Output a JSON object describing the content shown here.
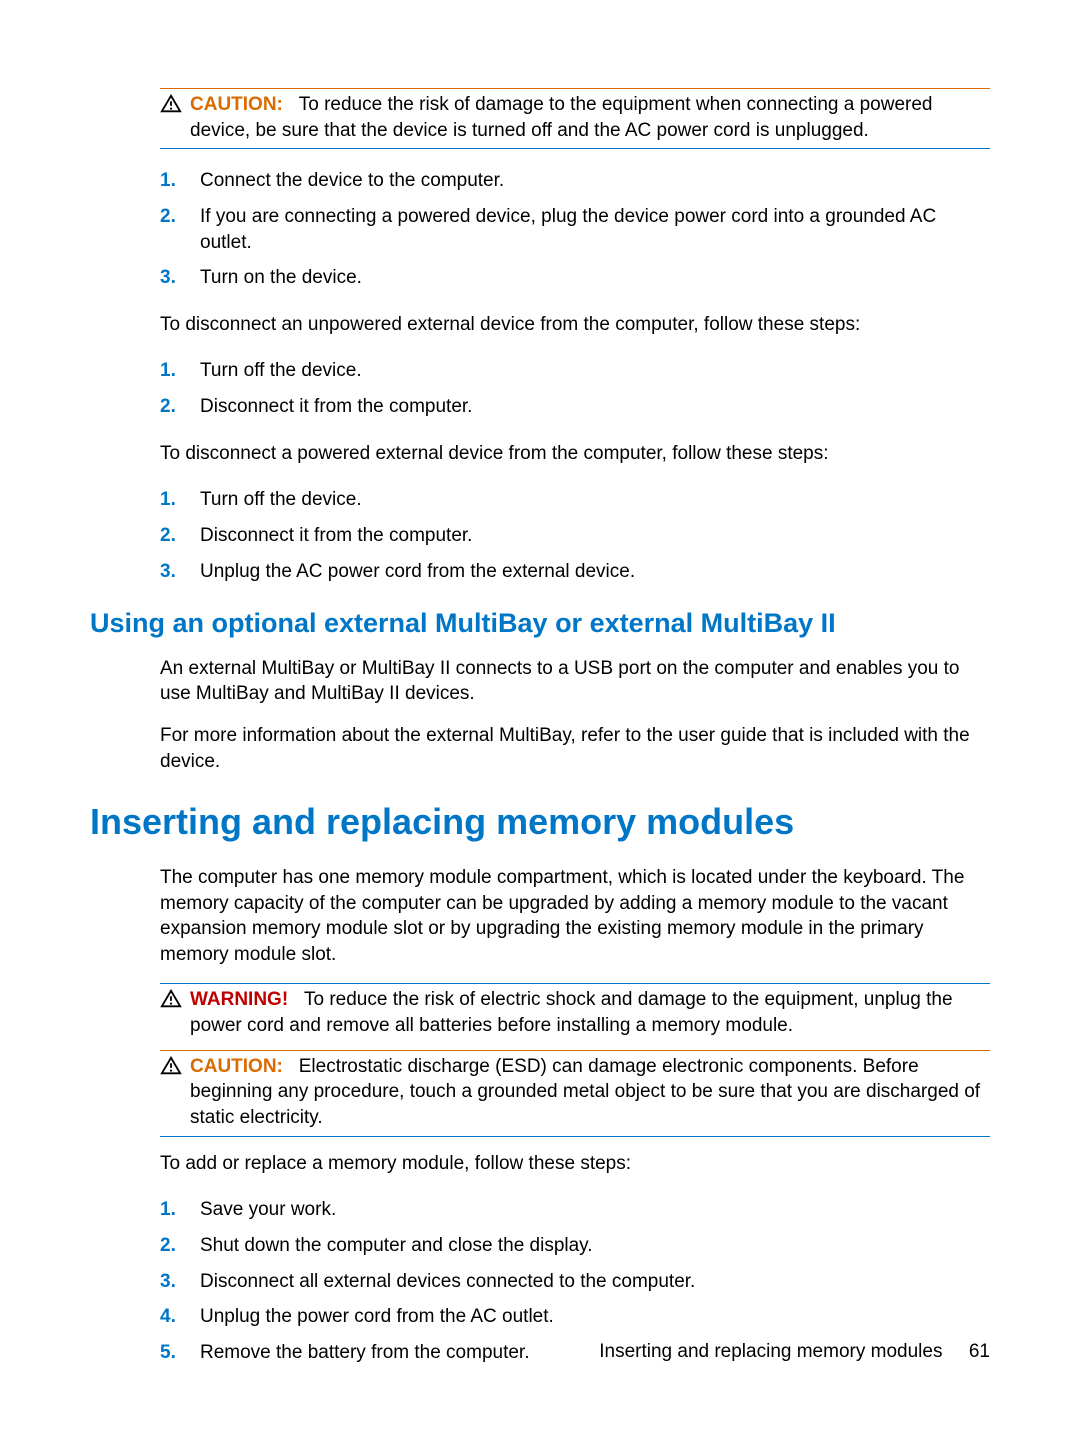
{
  "caution1": {
    "label": "CAUTION:",
    "text": "To reduce the risk of damage to the equipment when connecting a powered device, be sure that the device is turned off and the AC power cord is unplugged."
  },
  "list1": {
    "items": [
      {
        "n": "1.",
        "t": "Connect the device to the computer."
      },
      {
        "n": "2.",
        "t": "If you are connecting a powered device, plug the device power cord into a grounded AC outlet."
      },
      {
        "n": "3.",
        "t": "Turn on the device."
      }
    ]
  },
  "para1": "To disconnect an unpowered external device from the computer, follow these steps:",
  "list2": {
    "items": [
      {
        "n": "1.",
        "t": "Turn off the device."
      },
      {
        "n": "2.",
        "t": "Disconnect it from the computer."
      }
    ]
  },
  "para2": "To disconnect a powered external device from the computer, follow these steps:",
  "list3": {
    "items": [
      {
        "n": "1.",
        "t": "Turn off the device."
      },
      {
        "n": "2.",
        "t": "Disconnect it from the computer."
      },
      {
        "n": "3.",
        "t": "Unplug the AC power cord from the external device."
      }
    ]
  },
  "h2_1": "Using an optional external MultiBay or external MultiBay II",
  "para3": "An external MultiBay or MultiBay II connects to a USB port on the computer and enables you to use MultiBay and MultiBay II devices.",
  "para4": "For more information about the external MultiBay, refer to the user guide that is included with the device.",
  "h1_1": "Inserting and replacing memory modules",
  "para5": "The computer has one memory module compartment, which is located under the keyboard. The memory capacity of the computer can be upgraded by adding a memory module to the vacant expansion memory module slot or by upgrading the existing memory module in the primary memory module slot.",
  "warning1": {
    "label": "WARNING!",
    "text": "To reduce the risk of electric shock and damage to the equipment, unplug the power cord and remove all batteries before installing a memory module."
  },
  "caution2": {
    "label": "CAUTION:",
    "text": "Electrostatic discharge (ESD) can damage electronic components. Before beginning any procedure, touch a grounded metal object to be sure that you are discharged of static electricity."
  },
  "para6": "To add or replace a memory module, follow these steps:",
  "list4": {
    "items": [
      {
        "n": "1.",
        "t": "Save your work."
      },
      {
        "n": "2.",
        "t": "Shut down the computer and close the display."
      },
      {
        "n": "3.",
        "t": "Disconnect all external devices connected to the computer."
      },
      {
        "n": "4.",
        "t": "Unplug the power cord from the AC outlet."
      },
      {
        "n": "5.",
        "t": "Remove the battery from the computer."
      }
    ]
  },
  "footer": {
    "section": "Inserting and replacing memory modules",
    "page": "61"
  }
}
